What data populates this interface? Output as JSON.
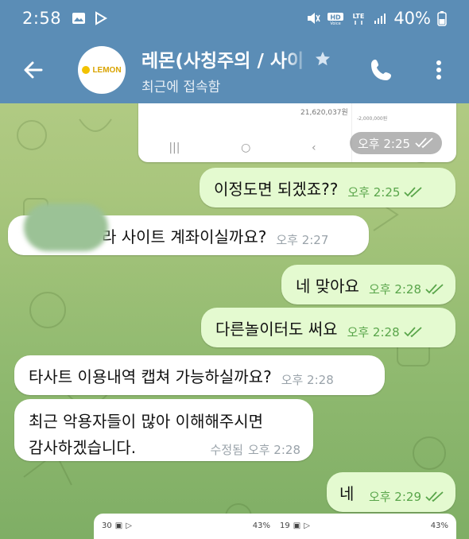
{
  "status_bar": {
    "time": "2:58",
    "battery": "40%"
  },
  "header": {
    "title": "레몬(사칭주의 / 사이",
    "subtitle": "최근에 접속함",
    "avatar_text": "LEMON",
    "avatar_color": "#f2c200"
  },
  "image_card": {
    "amount": "21,620,037원",
    "time": "오후 2:25",
    "mini_text": "-2,000,000원"
  },
  "messages": [
    {
      "text": "이정도면 되겠죠??",
      "time": "오후 2:25",
      "direction": "out"
    },
    {
      "text": "라 사이트 계좌이실까요?",
      "time": "오후 2:27",
      "direction": "in"
    },
    {
      "text": "네 맞아요",
      "time": "오후 2:28",
      "direction": "out"
    },
    {
      "text": "다른놀이터도 써요",
      "time": "오후 2:28",
      "direction": "out"
    },
    {
      "text": "타사트 이용내역 캡쳐 가능하실까요?",
      "time": "오후 2:28",
      "direction": "in"
    },
    {
      "text_line1": "최근 악용자들이 많아 이해해주시면",
      "text_line2": "감사하겠습니다.",
      "edited_label": "수정됨",
      "time": "오후 2:28",
      "direction": "in"
    },
    {
      "text": "네",
      "time": "오후 2:29",
      "direction": "out"
    }
  ],
  "preview": {
    "left_time": "30",
    "left_battery": "43%",
    "right_time": "19",
    "right_battery": "43%"
  },
  "colors": {
    "header_bg": "#5b8db6",
    "outgoing_bubble": "#e4fad0",
    "incoming_bubble": "#ffffff",
    "check_green": "#59a54a"
  }
}
